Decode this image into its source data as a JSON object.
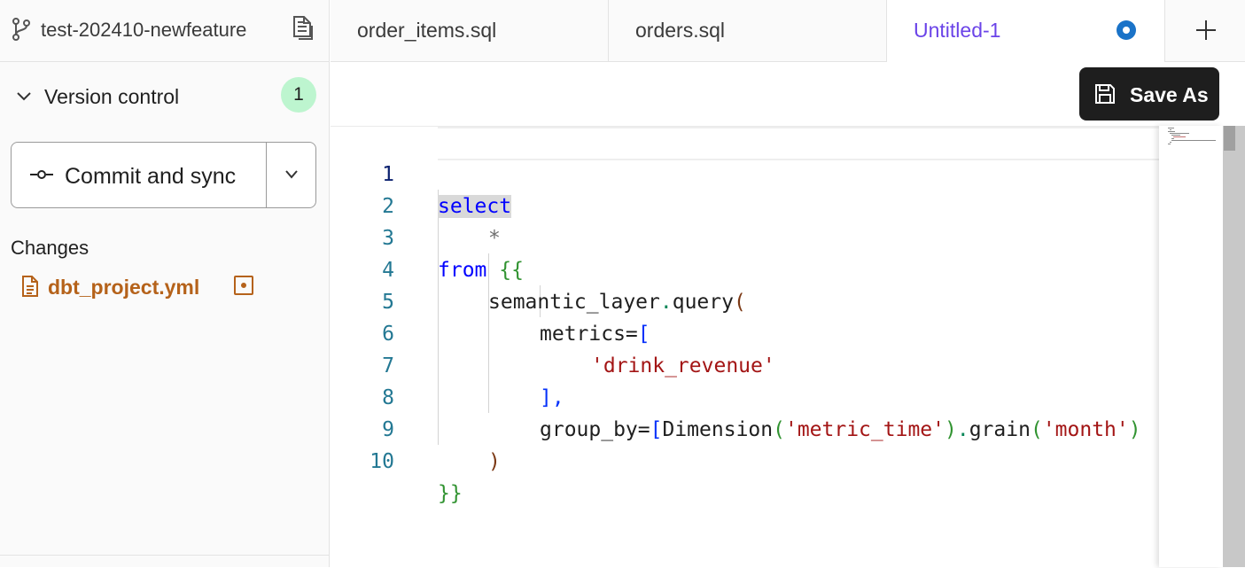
{
  "sidebar": {
    "branch": "test-202410-newfeature",
    "version_control": {
      "title": "Version control",
      "badge_count": "1",
      "commit_label": "Commit and sync"
    },
    "changes": {
      "title": "Changes",
      "files": [
        {
          "name": "dbt_project.yml",
          "status_icon": "modified-icon",
          "color": "#b5621a"
        }
      ]
    }
  },
  "tabs": [
    {
      "label": "order_items.sql",
      "active": false
    },
    {
      "label": "orders.sql",
      "active": false
    },
    {
      "label": "Untitled-1",
      "active": true,
      "unsaved": true
    }
  ],
  "toolbar": {
    "save_as_label": "Save As"
  },
  "editor": {
    "line_numbers": [
      "1",
      "2",
      "3",
      "4",
      "5",
      "6",
      "7",
      "8",
      "9",
      "10"
    ],
    "tokens": {
      "l1": "select",
      "l2": "*",
      "l3_kw": "from",
      "l3_br": "{{",
      "l4_fn": "semantic_layer",
      "l4_dot": ".",
      "l4_m": "query",
      "l4_br": "(",
      "l5_arg": "metrics=",
      "l5_br": "[",
      "l6_str": "'drink_revenue'",
      "l7_br": "]",
      "l7_comma": ",",
      "l8_arg": "group_by=",
      "l8_br": "[",
      "l8_fn": "Dimension",
      "l8_p1": "(",
      "l8_s1": "'metric_time'",
      "l8_p2": ")",
      "l8_dot": ".",
      "l8_m": "grain",
      "l8_p3": "(",
      "l8_s2": "'month'",
      "l8_p4": ")",
      "l9_br": ")",
      "l10_br": "}}"
    }
  },
  "colors": {
    "accent_tab": "#6b44e8",
    "badge_bg": "#bdf5cf",
    "unsaved_dot": "#1a73c8",
    "save_bg": "#1e1e1e"
  }
}
